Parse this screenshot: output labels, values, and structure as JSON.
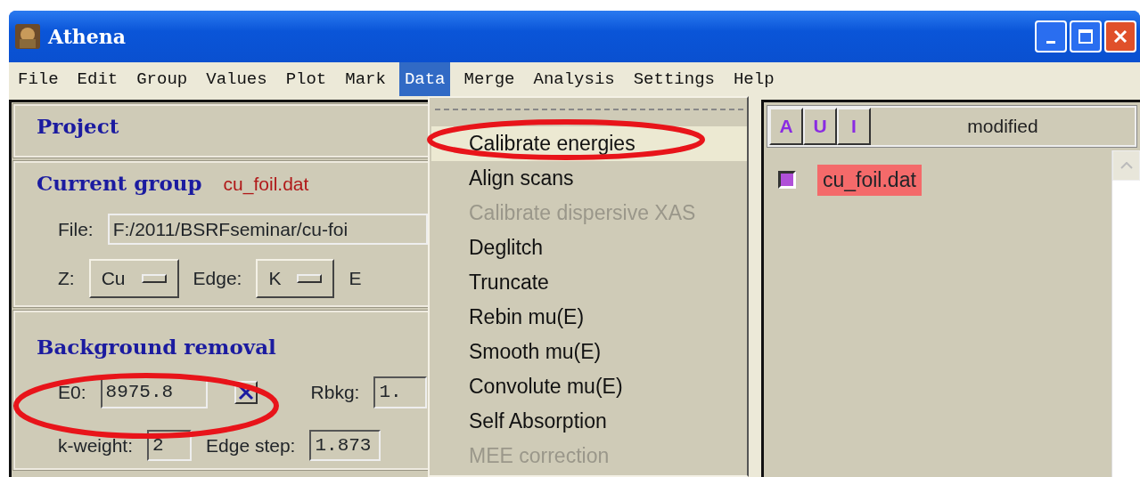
{
  "window": {
    "title": "Athena"
  },
  "menu": [
    {
      "label": "File",
      "selected": false
    },
    {
      "label": "Edit",
      "selected": false
    },
    {
      "label": "Group",
      "selected": false
    },
    {
      "label": "Values",
      "selected": false
    },
    {
      "label": "Plot",
      "selected": false
    },
    {
      "label": "Mark",
      "selected": false
    },
    {
      "label": "Data",
      "selected": true
    },
    {
      "label": "Merge",
      "selected": false
    },
    {
      "label": "Analysis",
      "selected": false
    },
    {
      "label": "Settings",
      "selected": false
    },
    {
      "label": "Help",
      "selected": false
    }
  ],
  "project": {
    "title": "Project"
  },
  "current_group": {
    "title": "Current group",
    "name": "cu_foil.dat",
    "file_label": "File:",
    "file_value": "F:/2011/BSRFseminar/cu-foi",
    "z_label": "Z:",
    "z_value": "Cu",
    "edge_label": "Edge:",
    "edge_value": "K",
    "e_label": "E"
  },
  "background_removal": {
    "title": "Background removal",
    "e0_label": "E0:",
    "e0_value": "8975.8",
    "e0_toggle_checked": true,
    "e0_circled": true,
    "rbkg_label": "Rbkg:",
    "rbkg_value": "1.",
    "kweight_label": "k-weight:",
    "kweight_value": "2",
    "edge_step_label": "Edge step:",
    "edge_step_value": "1.873"
  },
  "data_menu": {
    "items": [
      {
        "label": "Calibrate energies",
        "disabled": false,
        "selected": true,
        "circled": true
      },
      {
        "label": "Align scans",
        "disabled": false,
        "selected": false,
        "circled": false
      },
      {
        "label": "Calibrate dispersive XAS",
        "disabled": true,
        "selected": false,
        "circled": false
      },
      {
        "label": "Deglitch",
        "disabled": false,
        "selected": false,
        "circled": false
      },
      {
        "label": "Truncate",
        "disabled": false,
        "selected": false,
        "circled": false
      },
      {
        "label": "Rebin mu(E)",
        "disabled": false,
        "selected": false,
        "circled": false
      },
      {
        "label": "Smooth mu(E)",
        "disabled": false,
        "selected": false,
        "circled": false
      },
      {
        "label": "Convolute mu(E)",
        "disabled": false,
        "selected": false,
        "circled": false
      },
      {
        "label": "Self Absorption",
        "disabled": false,
        "selected": false,
        "circled": false
      },
      {
        "label": "MEE correction",
        "disabled": true,
        "selected": false,
        "circled": false
      }
    ]
  },
  "groups_panel": {
    "buttons": [
      "A",
      "U",
      "I"
    ],
    "header": "modified",
    "groups": [
      {
        "name": "cu_foil.dat",
        "selected": true,
        "checked": true
      }
    ]
  }
}
